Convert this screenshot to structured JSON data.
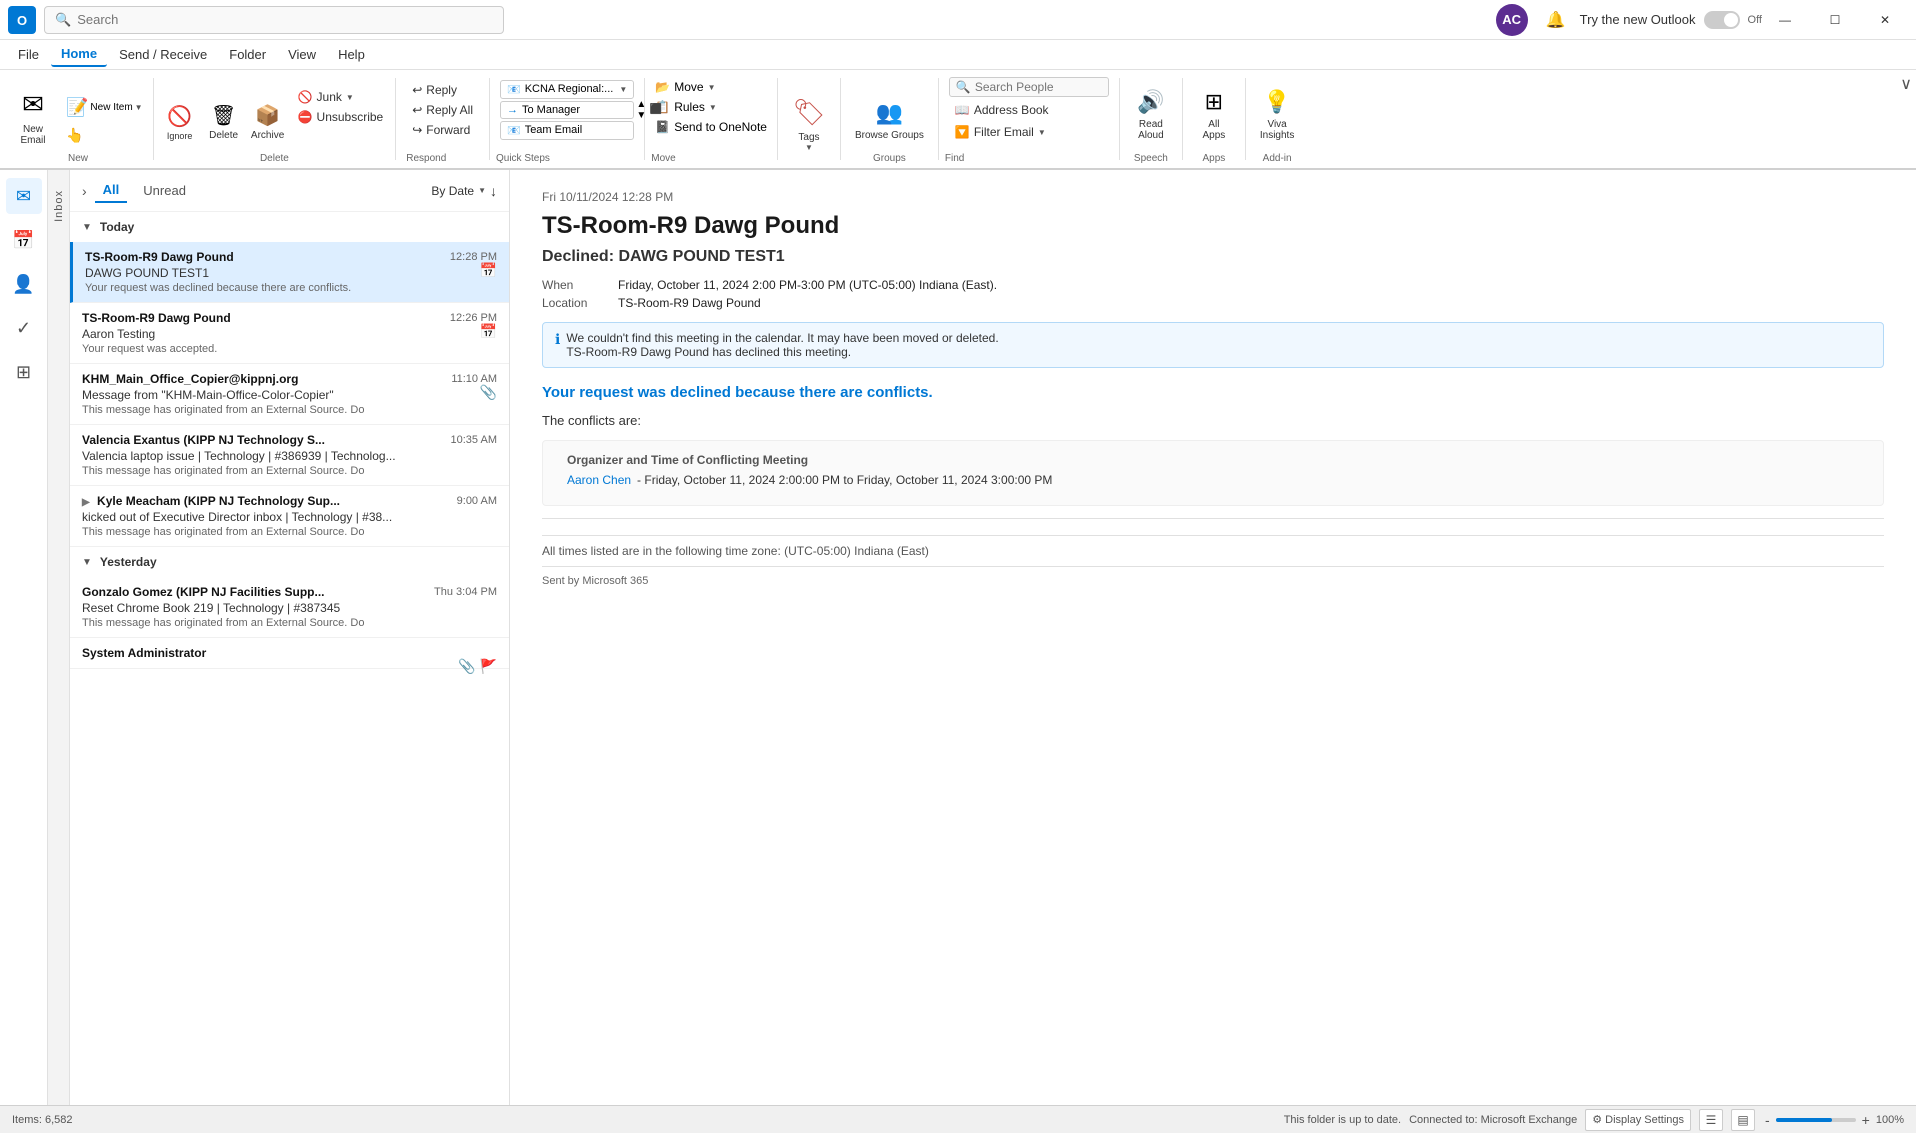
{
  "titlebar": {
    "app_name": "Outlook",
    "app_initial": "O",
    "search_placeholder": "Search",
    "avatar_initials": "AC",
    "try_new_label": "Try the new Outlook",
    "toggle_state": "Off",
    "minimize": "—",
    "maximize": "☐",
    "close": "✕"
  },
  "menubar": {
    "items": [
      "File",
      "Home",
      "Send / Receive",
      "Folder",
      "View",
      "Help"
    ],
    "active": "Home"
  },
  "ribbon": {
    "new_group": {
      "label": "New",
      "new_email": "New\nEmail",
      "new_item": "New\nItem"
    },
    "delete_group": {
      "label": "Delete",
      "ignore": "Ignore",
      "delete": "Delete",
      "archive": "Archive"
    },
    "respond_group": {
      "label": "Respond",
      "reply": "Reply",
      "reply_all": "Reply All",
      "forward": "Forward"
    },
    "quick_steps": {
      "label": "Quick Steps",
      "items": [
        {
          "icon": "📧",
          "text": "KCNA Regional:..."
        },
        {
          "icon": "→",
          "text": "To Manager"
        },
        {
          "icon": "📧",
          "text": "Team Email"
        }
      ]
    },
    "move_group": {
      "label": "Move",
      "move": "Move",
      "rules": "Rules",
      "send_to_onenote": "Send to OneNote"
    },
    "tags_group": {
      "label": "",
      "tags": "Tags"
    },
    "groups_group": {
      "label": "Groups",
      "browse_groups": "Browse Groups"
    },
    "find_group": {
      "label": "Find",
      "search_people": "Search People",
      "address_book": "Address Book",
      "filter_email": "Filter Email"
    },
    "speech_group": {
      "label": "Speech",
      "read_aloud": "Read\nAloud"
    },
    "apps_group": {
      "label": "Apps",
      "all_apps": "All\nApps"
    },
    "addin_group": {
      "label": "Add-in",
      "viva_insights": "Viva\nInsights"
    }
  },
  "nav_sidebar": {
    "icons": [
      {
        "name": "mail-nav",
        "symbol": "✉",
        "active": true
      },
      {
        "name": "calendar-nav",
        "symbol": "📅"
      },
      {
        "name": "contacts-nav",
        "symbol": "👤"
      },
      {
        "name": "tasks-nav",
        "symbol": "✓"
      },
      {
        "name": "groups-nav",
        "symbol": "⊞"
      }
    ]
  },
  "inbox_label": "Inbox",
  "email_list": {
    "tab_all": "All",
    "tab_unread": "Unread",
    "sort_label": "By Date",
    "groups": [
      {
        "label": "Today",
        "emails": [
          {
            "id": "e1",
            "sender": "TS-Room-R9 Dawg Pound",
            "subject": "DAWG POUND TEST1",
            "preview": "Your request was declined because there are conflicts.",
            "time": "12:28 PM",
            "icon": "📅",
            "selected": true,
            "has_expand": false
          },
          {
            "id": "e2",
            "sender": "TS-Room-R9 Dawg Pound",
            "subject": "Aaron Testing",
            "preview": "Your request was accepted.",
            "time": "12:26 PM",
            "icon": "📅",
            "selected": false,
            "has_expand": false
          },
          {
            "id": "e3",
            "sender": "KHM_Main_Office_Copier@kippnj.org",
            "subject": "Message from \"KHM-Main-Office-Color-Copier\"",
            "preview": "This message has originated from an External Source. Do",
            "time": "11:10 AM",
            "icon": "📎",
            "selected": false,
            "has_expand": false
          },
          {
            "id": "e4",
            "sender": "Valencia Exantus (KIPP NJ Technology S...",
            "subject": "Valencia laptop issue | Technology | #386939 | Technolog...",
            "preview": "This message has originated from an External Source. Do",
            "time": "10:35 AM",
            "icon": "",
            "selected": false,
            "has_expand": false
          },
          {
            "id": "e5",
            "sender": "Kyle Meacham (KIPP NJ Technology Sup...",
            "subject": "kicked out of Executive Director inbox | Technology | #38...",
            "preview": "This message has originated from an External Source. Do",
            "time": "9:00 AM",
            "icon": "",
            "selected": false,
            "has_expand": true
          }
        ]
      },
      {
        "label": "Yesterday",
        "emails": [
          {
            "id": "e6",
            "sender": "Gonzalo Gomez (KIPP NJ Facilities Supp...",
            "subject": "Reset Chrome Book 219 | Technology | #387345",
            "preview": "This message has originated from an External Source. Do",
            "time": "Thu 3:04 PM",
            "icon": "",
            "selected": false,
            "has_expand": false
          },
          {
            "id": "e7",
            "sender": "System Administrator",
            "subject": "",
            "preview": "",
            "time": "",
            "icon": "📎",
            "selected": false,
            "has_expand": false
          }
        ]
      }
    ]
  },
  "reading_pane": {
    "date_line": "Fri 10/11/2024 12:28 PM",
    "title": "TS-Room-R9 Dawg Pound",
    "subject": "Declined: DAWG POUND TEST1",
    "when_label": "When",
    "when_value": "Friday, October 11, 2024 2:00 PM-3:00 PM (UTC-05:00) Indiana (East).",
    "location_label": "Location",
    "location_value": "TS-Room-R9 Dawg Pound",
    "info_line1": "We couldn't find this meeting in the calendar. It may have been moved or deleted.",
    "info_line2": "TS-Room-R9 Dawg Pound has declined this meeting.",
    "declined_reason": "Your request was declined because there are conflicts.",
    "conflicts_intro": "The conflicts are:",
    "conflict_table_header": "Organizer and Time of Conflicting Meeting",
    "conflict_organizer": "Aaron Chen",
    "conflict_detail": "- Friday, October 11, 2024 2:00:00 PM to Friday, October 11, 2024 3:00:00 PM",
    "timezone_note": "All times listed are in the following time zone: (UTC-05:00) Indiana (East)",
    "sent_by": "Sent by Microsoft 365"
  },
  "statusbar": {
    "items_count": "Items: 6,582",
    "folder_status": "This folder is up to date.",
    "connected": "Connected to: Microsoft Exchange",
    "display_settings": "Display Settings",
    "zoom": "100%"
  }
}
